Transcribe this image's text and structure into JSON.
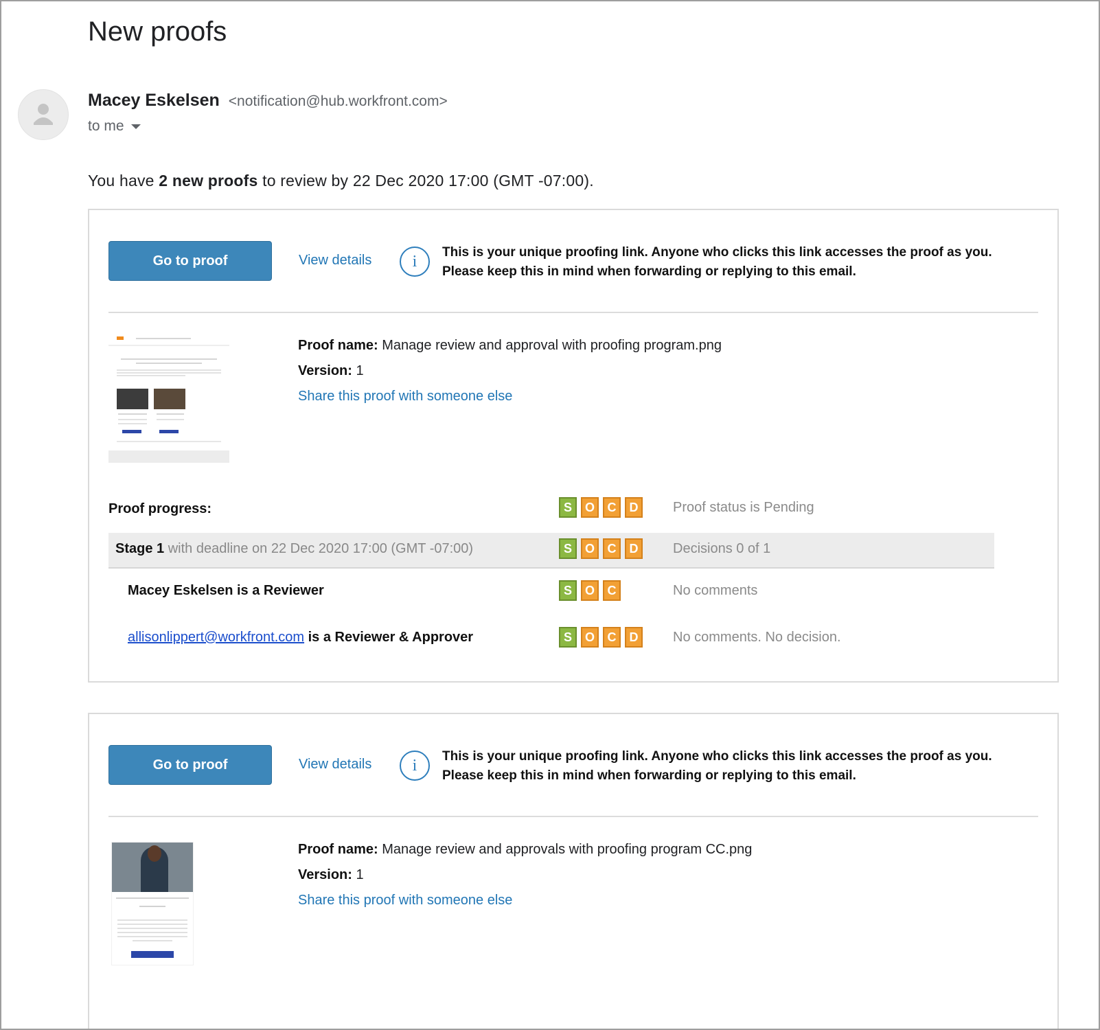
{
  "email": {
    "subject": "New proofs",
    "sender_name": "Macey Eskelsen",
    "sender_email": "<notification@hub.workfront.com>",
    "recipient": "to me",
    "intro_prefix": "You have ",
    "intro_bold": "2 new proofs",
    "intro_suffix": " to review by 22 Dec 2020 17:00 (GMT -07:00)."
  },
  "cards": [
    {
      "go_to_proof": "Go to proof",
      "view_details": "View details",
      "info_glyph": "i",
      "notice_line1": "This is your unique proofing link. Anyone who clicks this link accesses the proof as you.",
      "notice_line2": "Please keep this in mind when forwarding or replying to this email.",
      "proof_name_label": "Proof name:",
      "proof_name": "Manage review and approval with proofing program.png",
      "version_label": "Version:",
      "version": "1",
      "share": "Share this proof with someone else",
      "progress_label": "Proof progress:",
      "progress_badges": [
        "S",
        "O",
        "C",
        "D"
      ],
      "progress_status": "Proof status is Pending",
      "stage_name": "Stage 1",
      "stage_deadline": " with deadline on 22 Dec 2020 17:00 (GMT -07:00)",
      "stage_badges": [
        "S",
        "O",
        "C",
        "D"
      ],
      "stage_status": "Decisions 0 of 1",
      "reviewers": [
        {
          "name": "Macey Eskelsen is a Reviewer",
          "badges": [
            "S",
            "O",
            "C"
          ],
          "status": "No comments"
        },
        {
          "link": "allisonlippert@workfront.com",
          "role": " is a Reviewer & Approver",
          "badges": [
            "S",
            "O",
            "C",
            "D"
          ],
          "status": "No comments. No decision."
        }
      ]
    },
    {
      "go_to_proof": "Go to proof",
      "view_details": "View details",
      "info_glyph": "i",
      "notice_line1": "This is your unique proofing link. Anyone who clicks this link accesses the proof as you.",
      "notice_line2": "Please keep this in mind when forwarding or replying to this email.",
      "proof_name_label": "Proof name:",
      "proof_name": "Manage review and approvals with proofing program CC.png",
      "version_label": "Version:",
      "version": "1",
      "share": "Share this proof with someone else"
    }
  ],
  "colors": {
    "button": "#3d87ba",
    "link": "#2176b5",
    "badge_green": "#8cb843",
    "badge_orange": "#f2a035"
  },
  "icons": [
    "person-avatar-icon",
    "dropdown-caret-icon",
    "info-icon"
  ]
}
